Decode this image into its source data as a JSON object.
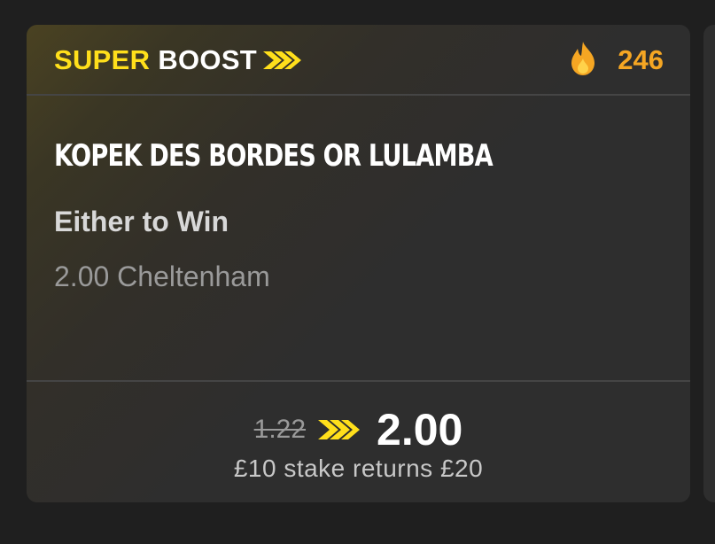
{
  "boost": {
    "label_super": "SUPER",
    "label_boost": "BOOST",
    "popularity_count": "246",
    "brand_color": "#ffdf1b",
    "count_color": "#f5a623",
    "icons": {
      "brand": "double-chevron-right-icon",
      "popularity": "flame-icon"
    }
  },
  "selection": {
    "title": "KOPEK DES BORDES OR LULAMBA",
    "market": "Either to Win",
    "event": "2.00 Cheltenham"
  },
  "odds": {
    "old": "1.22",
    "new": "2.00",
    "returns_text": "£10 stake returns £20"
  }
}
